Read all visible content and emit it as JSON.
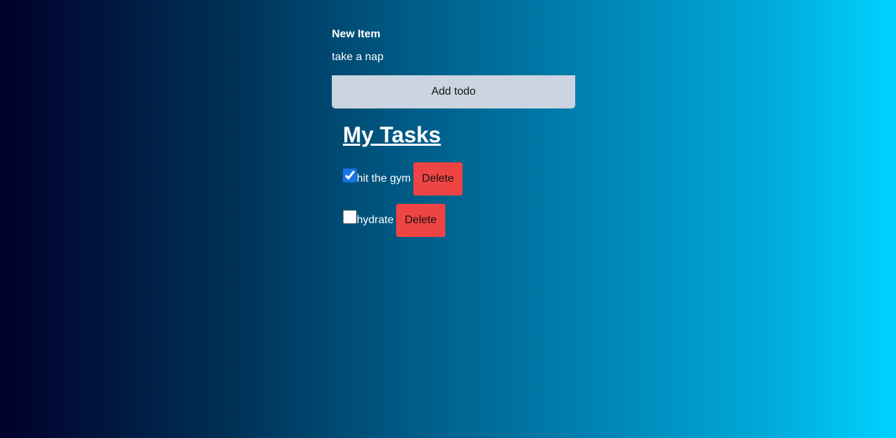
{
  "form": {
    "label": "New Item",
    "input_value": "take a nap",
    "submit_label": "Add todo"
  },
  "tasks": {
    "title": "My Tasks",
    "items": [
      {
        "text": "hit the gym",
        "checked": true,
        "delete_label": "Delete"
      },
      {
        "text": "hydrate",
        "checked": false,
        "delete_label": "Delete"
      }
    ]
  },
  "colors": {
    "button_bg": "#cbd5e1",
    "delete_bg": "#ef4444",
    "gradient_start": "#00002b",
    "gradient_end": "#00d2ff"
  }
}
